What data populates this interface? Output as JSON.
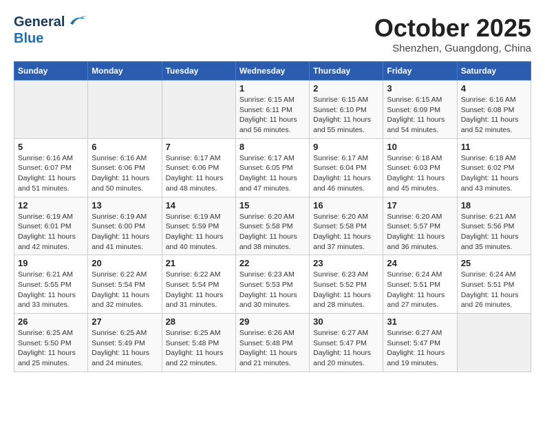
{
  "header": {
    "logo_general": "General",
    "logo_blue": "Blue",
    "month_title": "October 2025",
    "location": "Shenzhen, Guangdong, China"
  },
  "weekdays": [
    "Sunday",
    "Monday",
    "Tuesday",
    "Wednesday",
    "Thursday",
    "Friday",
    "Saturday"
  ],
  "weeks": [
    [
      {
        "day": "",
        "info": ""
      },
      {
        "day": "",
        "info": ""
      },
      {
        "day": "",
        "info": ""
      },
      {
        "day": "1",
        "info": "Sunrise: 6:15 AM\nSunset: 6:11 PM\nDaylight: 11 hours\nand 56 minutes."
      },
      {
        "day": "2",
        "info": "Sunrise: 6:15 AM\nSunset: 6:10 PM\nDaylight: 11 hours\nand 55 minutes."
      },
      {
        "day": "3",
        "info": "Sunrise: 6:15 AM\nSunset: 6:09 PM\nDaylight: 11 hours\nand 54 minutes."
      },
      {
        "day": "4",
        "info": "Sunrise: 6:16 AM\nSunset: 6:08 PM\nDaylight: 11 hours\nand 52 minutes."
      }
    ],
    [
      {
        "day": "5",
        "info": "Sunrise: 6:16 AM\nSunset: 6:07 PM\nDaylight: 11 hours\nand 51 minutes."
      },
      {
        "day": "6",
        "info": "Sunrise: 6:16 AM\nSunset: 6:06 PM\nDaylight: 11 hours\nand 50 minutes."
      },
      {
        "day": "7",
        "info": "Sunrise: 6:17 AM\nSunset: 6:06 PM\nDaylight: 11 hours\nand 48 minutes."
      },
      {
        "day": "8",
        "info": "Sunrise: 6:17 AM\nSunset: 6:05 PM\nDaylight: 11 hours\nand 47 minutes."
      },
      {
        "day": "9",
        "info": "Sunrise: 6:17 AM\nSunset: 6:04 PM\nDaylight: 11 hours\nand 46 minutes."
      },
      {
        "day": "10",
        "info": "Sunrise: 6:18 AM\nSunset: 6:03 PM\nDaylight: 11 hours\nand 45 minutes."
      },
      {
        "day": "11",
        "info": "Sunrise: 6:18 AM\nSunset: 6:02 PM\nDaylight: 11 hours\nand 43 minutes."
      }
    ],
    [
      {
        "day": "12",
        "info": "Sunrise: 6:19 AM\nSunset: 6:01 PM\nDaylight: 11 hours\nand 42 minutes."
      },
      {
        "day": "13",
        "info": "Sunrise: 6:19 AM\nSunset: 6:00 PM\nDaylight: 11 hours\nand 41 minutes."
      },
      {
        "day": "14",
        "info": "Sunrise: 6:19 AM\nSunset: 5:59 PM\nDaylight: 11 hours\nand 40 minutes."
      },
      {
        "day": "15",
        "info": "Sunrise: 6:20 AM\nSunset: 5:58 PM\nDaylight: 11 hours\nand 38 minutes."
      },
      {
        "day": "16",
        "info": "Sunrise: 6:20 AM\nSunset: 5:58 PM\nDaylight: 11 hours\nand 37 minutes."
      },
      {
        "day": "17",
        "info": "Sunrise: 6:20 AM\nSunset: 5:57 PM\nDaylight: 11 hours\nand 36 minutes."
      },
      {
        "day": "18",
        "info": "Sunrise: 6:21 AM\nSunset: 5:56 PM\nDaylight: 11 hours\nand 35 minutes."
      }
    ],
    [
      {
        "day": "19",
        "info": "Sunrise: 6:21 AM\nSunset: 5:55 PM\nDaylight: 11 hours\nand 33 minutes."
      },
      {
        "day": "20",
        "info": "Sunrise: 6:22 AM\nSunset: 5:54 PM\nDaylight: 11 hours\nand 32 minutes."
      },
      {
        "day": "21",
        "info": "Sunrise: 6:22 AM\nSunset: 5:54 PM\nDaylight: 11 hours\nand 31 minutes."
      },
      {
        "day": "22",
        "info": "Sunrise: 6:23 AM\nSunset: 5:53 PM\nDaylight: 11 hours\nand 30 minutes."
      },
      {
        "day": "23",
        "info": "Sunrise: 6:23 AM\nSunset: 5:52 PM\nDaylight: 11 hours\nand 28 minutes."
      },
      {
        "day": "24",
        "info": "Sunrise: 6:24 AM\nSunset: 5:51 PM\nDaylight: 11 hours\nand 27 minutes."
      },
      {
        "day": "25",
        "info": "Sunrise: 6:24 AM\nSunset: 5:51 PM\nDaylight: 11 hours\nand 26 minutes."
      }
    ],
    [
      {
        "day": "26",
        "info": "Sunrise: 6:25 AM\nSunset: 5:50 PM\nDaylight: 11 hours\nand 25 minutes."
      },
      {
        "day": "27",
        "info": "Sunrise: 6:25 AM\nSunset: 5:49 PM\nDaylight: 11 hours\nand 24 minutes."
      },
      {
        "day": "28",
        "info": "Sunrise: 6:25 AM\nSunset: 5:48 PM\nDaylight: 11 hours\nand 22 minutes."
      },
      {
        "day": "29",
        "info": "Sunrise: 6:26 AM\nSunset: 5:48 PM\nDaylight: 11 hours\nand 21 minutes."
      },
      {
        "day": "30",
        "info": "Sunrise: 6:27 AM\nSunset: 5:47 PM\nDaylight: 11 hours\nand 20 minutes."
      },
      {
        "day": "31",
        "info": "Sunrise: 6:27 AM\nSunset: 5:47 PM\nDaylight: 11 hours\nand 19 minutes."
      },
      {
        "day": "",
        "info": ""
      }
    ]
  ]
}
